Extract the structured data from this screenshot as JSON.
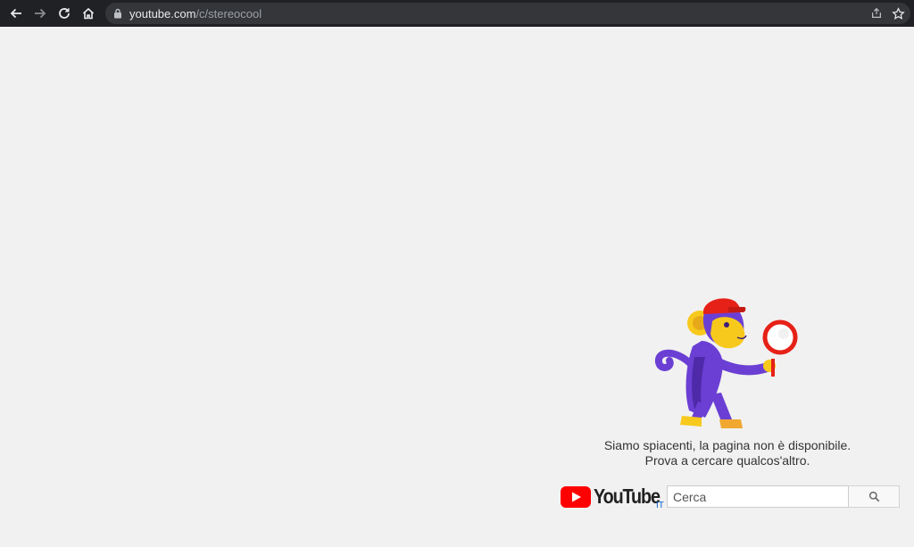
{
  "browser": {
    "url_host": "youtube.com",
    "url_path": "/c/stereocool",
    "icons": [
      "back-arrow-icon",
      "forward-arrow-icon",
      "reload-icon",
      "home-icon",
      "lock-icon",
      "share-icon",
      "star-icon"
    ]
  },
  "error": {
    "line1": "Siamo spiacenti, la pagina non è disponibile.",
    "line2": "Prova a cercare qualcos'altro."
  },
  "logo": {
    "wordmark": "YouTube",
    "country": "IT"
  },
  "search": {
    "placeholder": "Cerca"
  },
  "colors": {
    "toolbar": "#202124",
    "page_bg": "#f1f1f1",
    "youtube_red": "#ff0000",
    "monkey_purple": "#6b3fd4",
    "monkey_face": "#f7c91c",
    "cap_red": "#e62117"
  }
}
